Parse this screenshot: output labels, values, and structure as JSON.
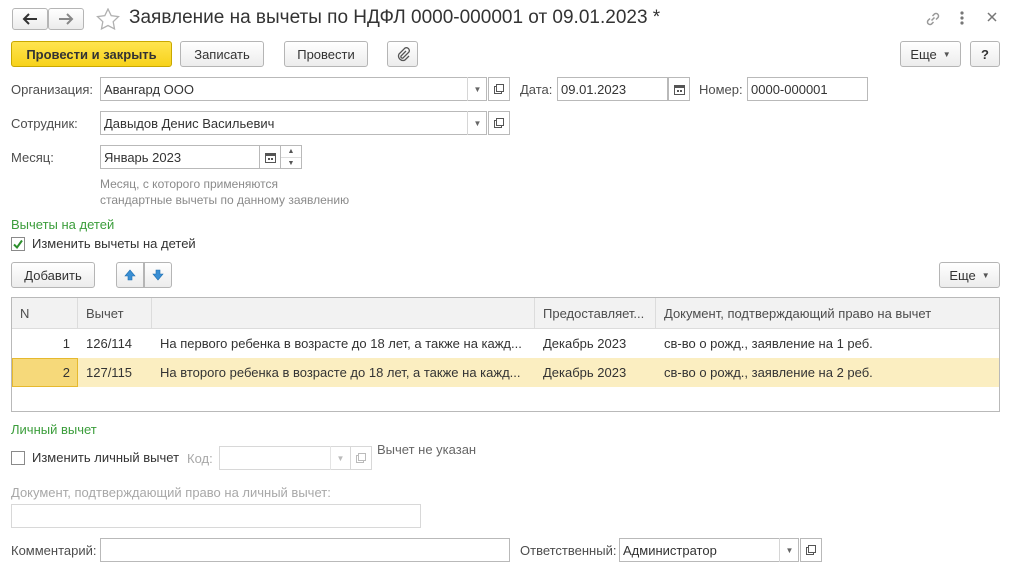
{
  "window": {
    "title": "Заявление на вычеты по НДФЛ 0000-000001 от 09.01.2023 *"
  },
  "toolbar": {
    "post_close": "Провести и закрыть",
    "save": "Записать",
    "post": "Провести",
    "more": "Еще",
    "help": "?"
  },
  "form": {
    "org_label": "Организация:",
    "org_value": "Авангард ООО",
    "date_label": "Дата:",
    "date_value": "09.01.2023",
    "number_label": "Номер:",
    "number_value": "0000-000001",
    "employee_label": "Сотрудник:",
    "employee_value": "Давыдов Денис Васильевич",
    "month_label": "Месяц:",
    "month_value": "Январь 2023",
    "month_hint_1": "Месяц, с которого применяются",
    "month_hint_2": "стандартные вычеты по данному заявлению"
  },
  "children": {
    "section_title": "Вычеты на детей",
    "change_checkbox": "Изменить вычеты на детей",
    "add_button": "Добавить",
    "more_button": "Еще",
    "columns": [
      "N",
      "Вычет",
      "",
      "Предоставляет...",
      "Документ, подтверждающий право на вычет"
    ],
    "rows": [
      {
        "n": "1",
        "code": "126/114",
        "desc": "На первого ребенка в возрасте до 18 лет, а также на кажд...",
        "period": "Декабрь 2023",
        "doc": "св-во о рожд., заявление на 1 реб."
      },
      {
        "n": "2",
        "code": "127/115",
        "desc": "На второго ребенка в возрасте до 18 лет, а также на кажд...",
        "period": "Декабрь 2023",
        "doc": "св-во о рожд., заявление на 2 реб."
      }
    ]
  },
  "personal": {
    "section_title": "Личный вычет",
    "change_checkbox": "Изменить личный вычет",
    "code_label": "Код:",
    "not_set": "Вычет не указан",
    "doc_label": "Документ, подтверждающий право на личный вычет:"
  },
  "footer": {
    "comment_label": "Комментарий:",
    "responsible_label": "Ответственный:",
    "responsible_value": "Администратор"
  },
  "colors": {
    "accent_yellow": "#f7d21b",
    "section_green": "#3b9d3b",
    "selected_row": "#fbeec1"
  }
}
